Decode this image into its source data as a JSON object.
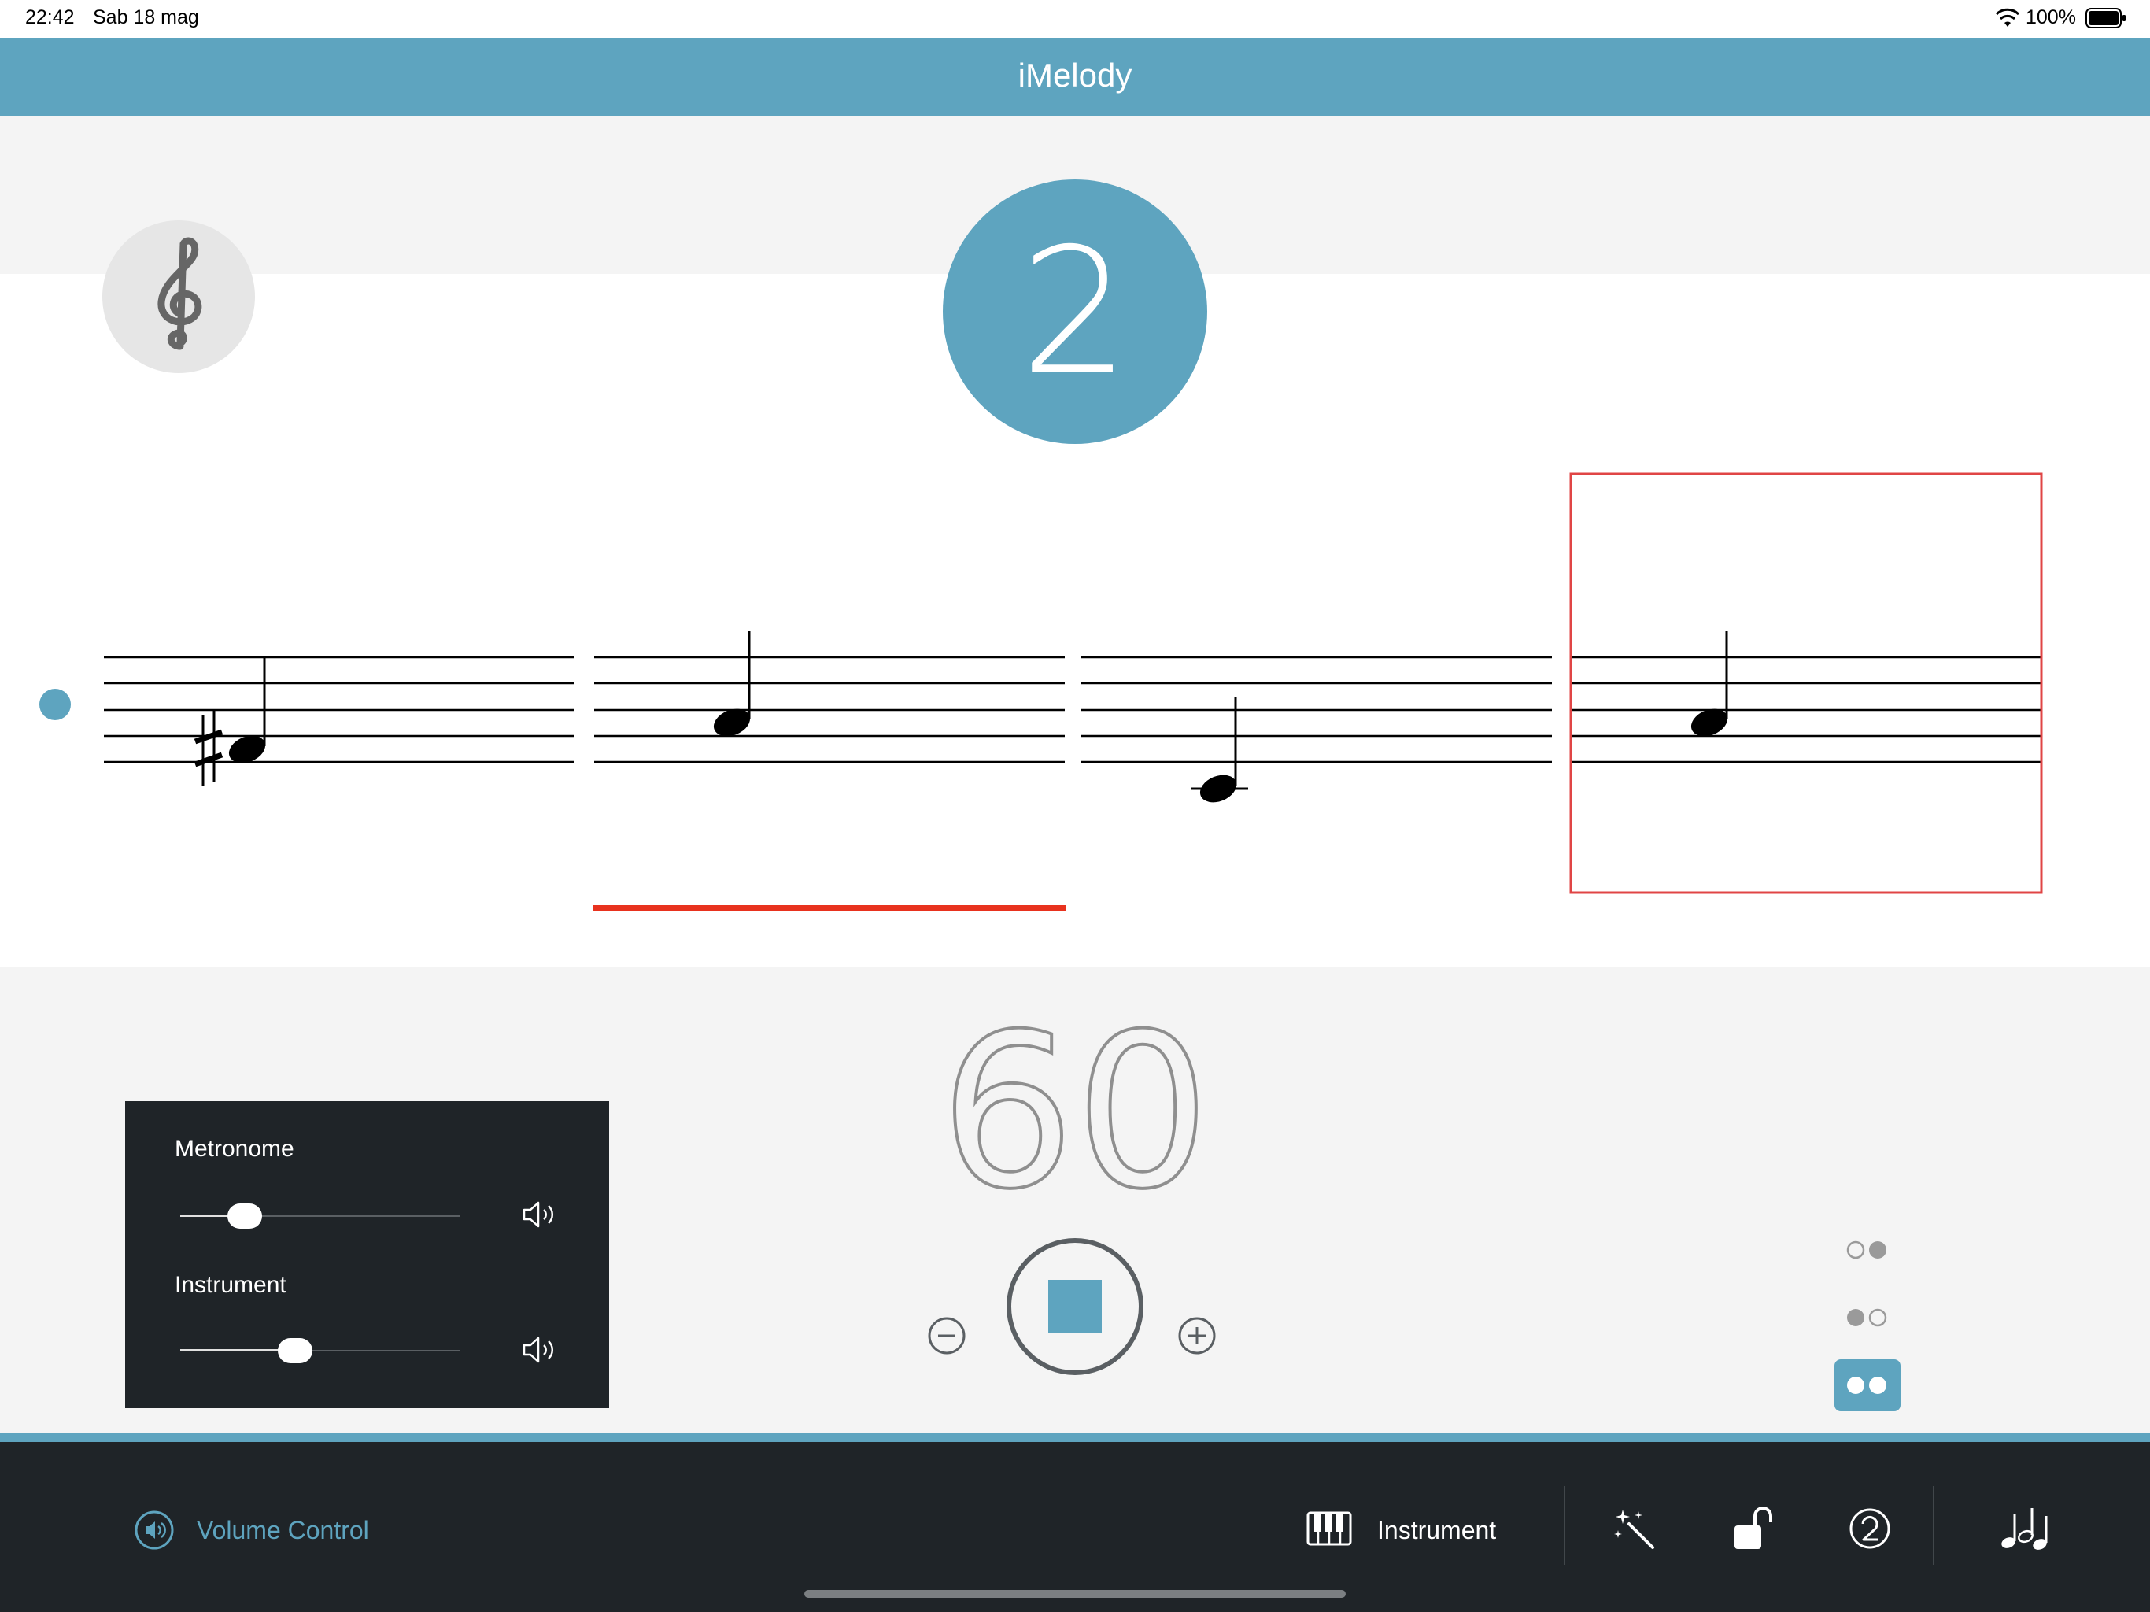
{
  "status_bar": {
    "time": "22:42",
    "date": "Sab 18 mag",
    "battery_percent": "100%"
  },
  "header": {
    "title": "iMelody"
  },
  "count_in": {
    "value": "2"
  },
  "tempo": {
    "bpm": "60"
  },
  "volume_panel": {
    "metronome_label": "Metronome",
    "metronome_level": 0.23,
    "instrument_label": "Instrument",
    "instrument_level": 0.41
  },
  "toolbar": {
    "volume_control_label": "Volume Control",
    "instrument_label": "Instrument"
  },
  "icons": {
    "clef": "treble-clef-icon",
    "wifi": "wifi-icon",
    "battery": "battery-icon",
    "minus": "minus-circle-icon",
    "plus": "plus-circle-icon",
    "stop": "stop-icon",
    "speaker": "speaker-icon",
    "piano": "piano-keyboard-icon",
    "magic": "magic-wand-icon",
    "lock": "unlock-icon",
    "count": "count-two-icon",
    "notes": "music-notes-icon"
  },
  "colors": {
    "accent": "#5ea4bf",
    "error_underline": "#e8321e",
    "selection_box": "#e04545",
    "toolbar_bg": "#1f2428"
  }
}
